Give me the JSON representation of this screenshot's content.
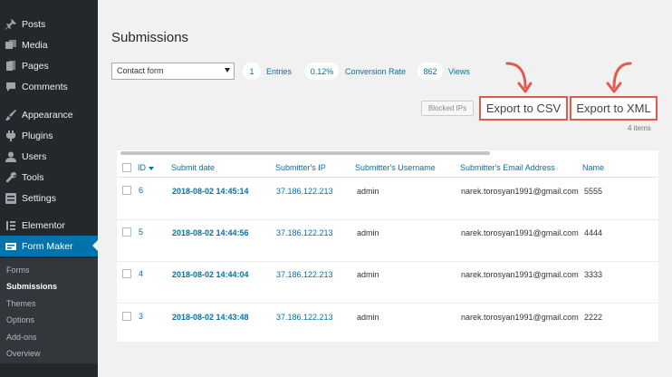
{
  "sidebar": {
    "items": [
      {
        "label": "Posts",
        "icon": "pin-icon"
      },
      {
        "label": "Media",
        "icon": "media-icon"
      },
      {
        "label": "Pages",
        "icon": "pages-icon"
      },
      {
        "label": "Comments",
        "icon": "comment-icon"
      },
      {
        "label": "Appearance",
        "icon": "brush-icon"
      },
      {
        "label": "Plugins",
        "icon": "plugin-icon"
      },
      {
        "label": "Users",
        "icon": "user-icon"
      },
      {
        "label": "Tools",
        "icon": "wrench-icon"
      },
      {
        "label": "Settings",
        "icon": "settings-icon"
      },
      {
        "label": "Elementor",
        "icon": "elementor-icon"
      },
      {
        "label": "Form Maker",
        "icon": "form-icon"
      }
    ],
    "submenu": [
      "Forms",
      "Submissions",
      "Themes",
      "Options",
      "Add-ons",
      "Overview"
    ]
  },
  "main": {
    "title": "Submissions",
    "form_select": "Contact form",
    "stats": {
      "entries_value": "1",
      "entries_label": "Entries",
      "conversion_value": "0.12%",
      "conversion_label": "Conversion Rate",
      "views_value": "862",
      "views_label": "Views"
    },
    "buttons": {
      "blocked_ips": "Blocked IPs",
      "export_csv": "Export to CSV",
      "export_xml": "Export to XML"
    },
    "items_count": "4 items"
  },
  "table": {
    "headers": [
      "ID",
      "Submit date",
      "Submitter's IP",
      "Submitter's Username",
      "Submitter's Email Address",
      "Name"
    ],
    "rows": [
      {
        "id": "6",
        "date": "2018-08-02 14:45:14",
        "ip": "37.186.122.213",
        "username": "admin",
        "email": "narek.torosyan1991@gmail.com",
        "name": "5555"
      },
      {
        "id": "5",
        "date": "2018-08-02 14:44:56",
        "ip": "37.186.122.213",
        "username": "admin",
        "email": "narek.torosyan1991@gmail.com",
        "name": "4444"
      },
      {
        "id": "4",
        "date": "2018-08-02 14:44:04",
        "ip": "37.186.122.213",
        "username": "admin",
        "email": "narek.torosyan1991@gmail.com",
        "name": "3333"
      },
      {
        "id": "3",
        "date": "2018-08-02 14:43:48",
        "ip": "37.186.122.213",
        "username": "admin",
        "email": "narek.torosyan1991@gmail.com",
        "name": "2222"
      }
    ]
  },
  "colors": {
    "sidebar_bg": "#23282d",
    "accent": "#0073aa",
    "highlight": "#e05a4f"
  }
}
